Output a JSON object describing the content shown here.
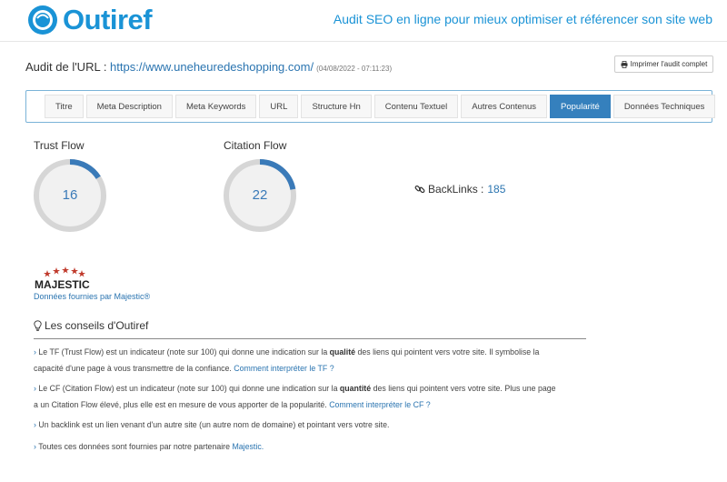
{
  "header": {
    "brand": "Outiref",
    "tagline": "Audit SEO en ligne pour mieux optimiser et référencer son site web"
  },
  "audit": {
    "prefix": "Audit de l'URL : ",
    "url": "https://www.uneheuredeshopping.com/",
    "date": "(04/08/2022 - 07:11:23)",
    "print_label": "Imprimer l'audit complet"
  },
  "tabs": [
    {
      "label": "Titre",
      "active": false
    },
    {
      "label": "Meta Description",
      "active": false
    },
    {
      "label": "Meta Keywords",
      "active": false
    },
    {
      "label": "URL",
      "active": false
    },
    {
      "label": "Structure Hn",
      "active": false
    },
    {
      "label": "Contenu Textuel",
      "active": false
    },
    {
      "label": "Autres Contenus",
      "active": false
    },
    {
      "label": "Popularité",
      "active": true
    },
    {
      "label": "Données Techniques",
      "active": false
    }
  ],
  "metrics": {
    "trust_flow": {
      "label": "Trust Flow",
      "value": "16",
      "max": 100
    },
    "citation_flow": {
      "label": "Citation Flow",
      "value": "22",
      "max": 100
    },
    "backlinks": {
      "label": "BackLinks :",
      "value": "185"
    }
  },
  "majestic": {
    "logo_text": "MAJESTIC",
    "note": "Données fournies par Majestic®"
  },
  "advice": {
    "title": "Les conseils d'Outiref",
    "p1": {
      "a": "Le TF (Trust Flow) est un indicateur (note sur 100) qui donne une indication sur la ",
      "b": "qualité",
      "c": " des liens qui pointent vers votre site. Il symbolise la",
      "d": "capacité d'une page à vous transmettre de la confiance. ",
      "link": "Comment interpréter le TF ?"
    },
    "p2": {
      "a": "Le CF (Citation Flow) est un indicateur (note sur 100) qui donne une indication sur la ",
      "b": "quantité",
      "c": " des liens qui pointent vers votre site. Plus une page",
      "d": "a un Citation Flow élevé, plus elle est en mesure de vous apporter de la popularité. ",
      "link": "Comment interpréter le CF ?"
    },
    "p3": "Un backlink est un lien venant d'un autre site (un autre nom de domaine) et pointant vers votre site.",
    "p4": {
      "a": "Toutes ces données sont fournies par notre partenaire ",
      "link": "Majestic."
    }
  },
  "colors": {
    "brand": "#1a93d6",
    "accent": "#3580bd",
    "gauge_track": "#d6d6d6",
    "gauge_fill": "#3a7ab8"
  }
}
